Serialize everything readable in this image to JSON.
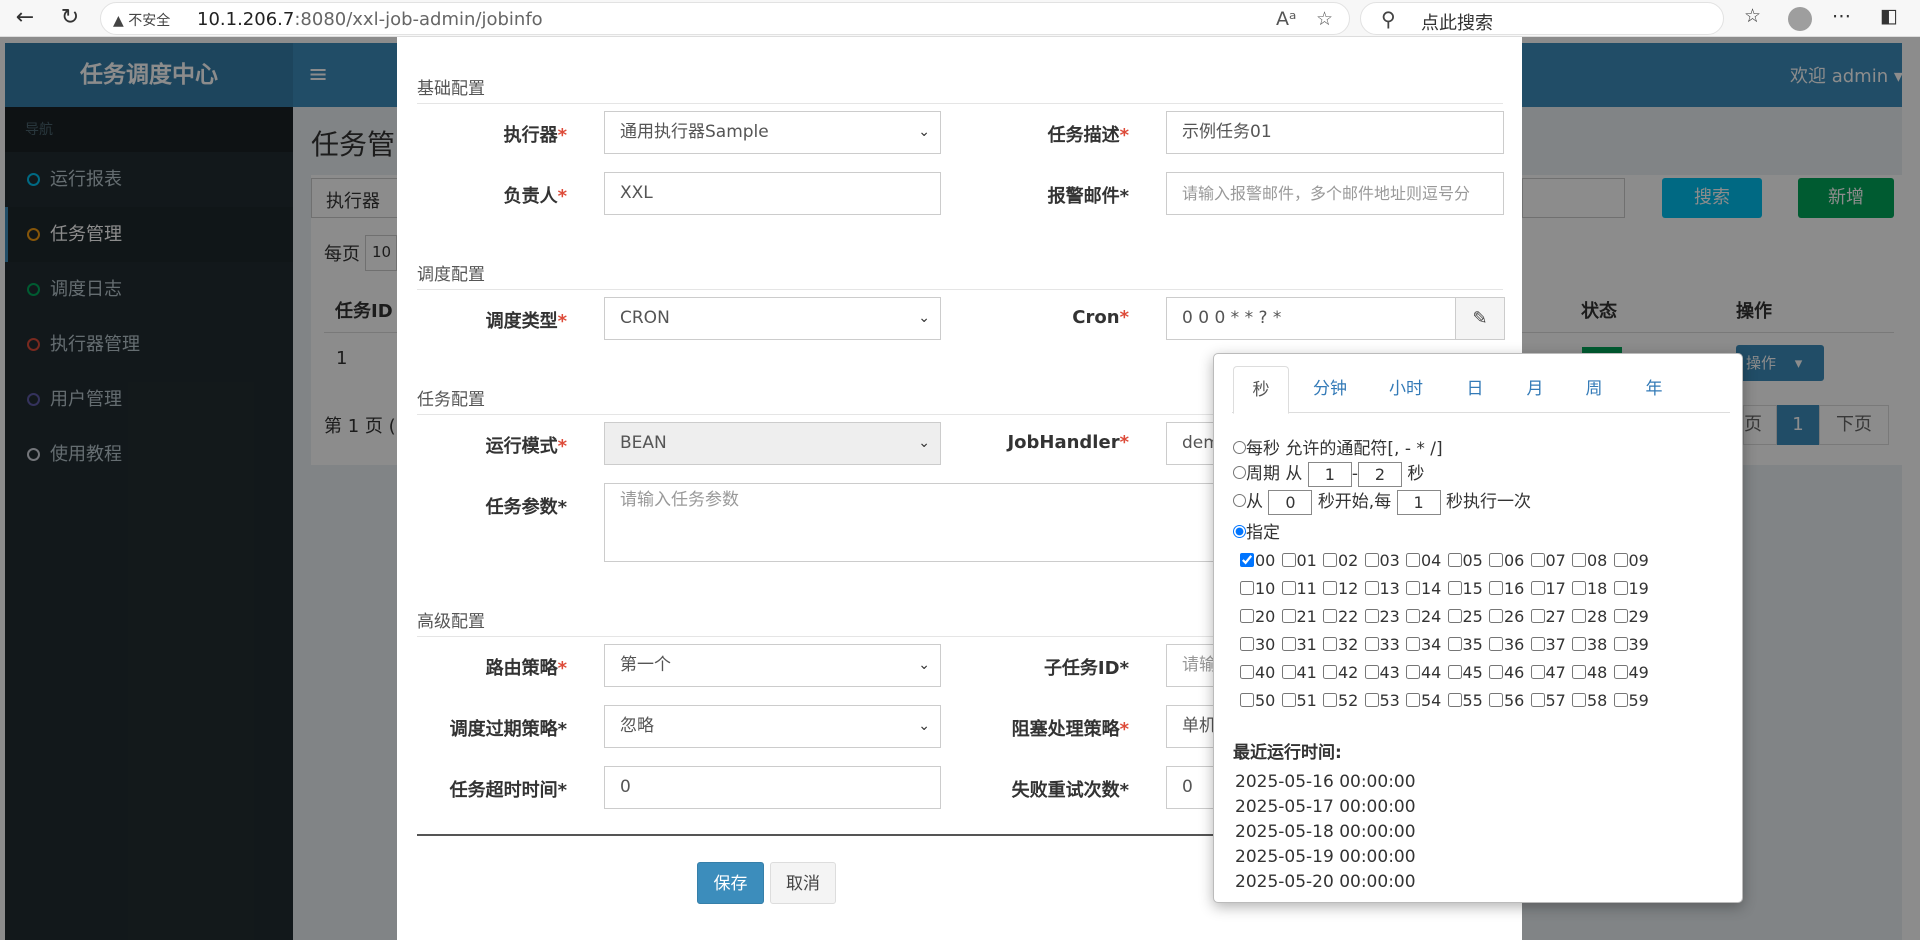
{
  "browser": {
    "security_label": "不安全",
    "url_host": "10.1.206.7",
    "url_path": ":8080/xxl-job-admin/jobinfo",
    "search_placeholder": "点此搜索"
  },
  "header": {
    "logo": "任务调度中心",
    "welcome": "欢迎 admin"
  },
  "sidebar": {
    "header": "导航",
    "items": [
      {
        "label": "运行报表",
        "color": "#00c0ef"
      },
      {
        "label": "任务管理",
        "color": "#f39c12"
      },
      {
        "label": "调度日志",
        "color": "#00a65a"
      },
      {
        "label": "执行器管理",
        "color": "#dd4b39"
      },
      {
        "label": "用户管理",
        "color": "#605ca8"
      },
      {
        "label": "使用教程",
        "color": "#d2d6de"
      }
    ]
  },
  "background": {
    "title": "任务管",
    "filter_executor": "执行器",
    "search_btn": "搜索",
    "add_btn": "新增",
    "per_page": "每页",
    "per_page_value": "10",
    "col_id": "任务ID",
    "col_status": "状态",
    "col_ops": "操作",
    "row_id": "1",
    "op_btn": "操作",
    "page_info": "第 1 页 ( /",
    "prev": "页",
    "page_num": "1",
    "next": "下页"
  },
  "form": {
    "section_basic": "基础配置",
    "executor_label": "执行器",
    "executor_value": "通用执行器Sample",
    "desc_label": "任务描述",
    "desc_value": "示例任务01",
    "owner_label": "负责人",
    "owner_value": "XXL",
    "email_label": "报警邮件*",
    "email_placeholder": "请输入报警邮件，多个邮件地址则逗号分",
    "section_schedule": "调度配置",
    "schedule_type_label": "调度类型",
    "schedule_type_value": "CRON",
    "cron_label": "Cron",
    "cron_value": "0 0 0 * * ? *",
    "section_task": "任务配置",
    "run_mode_label": "运行模式",
    "run_mode_value": "BEAN",
    "jobhandler_label": "JobHandler",
    "jobhandler_value": "dem",
    "params_label": "任务参数*",
    "params_placeholder": "请输入任务参数",
    "section_advanced": "高级配置",
    "route_label": "路由策略",
    "route_value": "第一个",
    "child_label": "子任务ID*",
    "child_placeholder": "请输",
    "misfire_label": "调度过期策略*",
    "misfire_value": "忽略",
    "block_label": "阻塞处理策略",
    "block_value": "单机",
    "timeout_label": "任务超时时间*",
    "timeout_value": "0",
    "retry_label": "失败重试次数*",
    "retry_value": "0",
    "save": "保存",
    "cancel": "取消"
  },
  "cron": {
    "tabs": [
      "秒",
      "分钟",
      "小时",
      "日",
      "月",
      "周",
      "年"
    ],
    "opt_every": "每秒 允许的通配符[, - * /]",
    "opt_cycle_prefix": "周期 从",
    "cycle_from": "1",
    "cycle_dash": "-",
    "cycle_to": "2",
    "cycle_unit": "秒",
    "opt_from_prefix": "从",
    "from_start": "0",
    "from_mid": "秒开始,每",
    "from_every": "1",
    "from_suffix": "秒执行一次",
    "opt_specify": "指定",
    "seconds": [
      "00",
      "01",
      "02",
      "03",
      "04",
      "05",
      "06",
      "07",
      "08",
      "09",
      "10",
      "11",
      "12",
      "13",
      "14",
      "15",
      "16",
      "17",
      "18",
      "19",
      "20",
      "21",
      "22",
      "23",
      "24",
      "25",
      "26",
      "27",
      "28",
      "29",
      "30",
      "31",
      "32",
      "33",
      "34",
      "35",
      "36",
      "37",
      "38",
      "39",
      "40",
      "41",
      "42",
      "43",
      "44",
      "45",
      "46",
      "47",
      "48",
      "49",
      "50",
      "51",
      "52",
      "53",
      "54",
      "55",
      "56",
      "57",
      "58",
      "59"
    ],
    "checked": [
      "00"
    ],
    "recent_title": "最近运行时间:",
    "recent_times": [
      "2025-05-16 00:00:00",
      "2025-05-17 00:00:00",
      "2025-05-18 00:00:00",
      "2025-05-19 00:00:00",
      "2025-05-20 00:00:00"
    ]
  }
}
